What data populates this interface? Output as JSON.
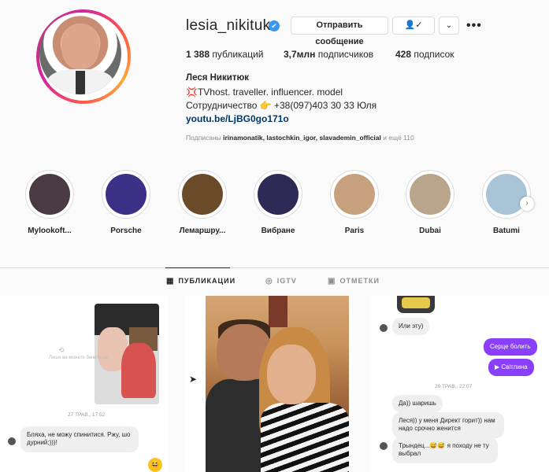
{
  "profile": {
    "username": "lesia_nikituk",
    "verified_glyph": "✔",
    "message_button": "Отправить сообщение",
    "follow_glyph": "👤✓",
    "dropdown_glyph": "⌄",
    "more_glyph": "•••",
    "posts_count": "1 388",
    "posts_label": "публикаций",
    "followers_count": "3,7млн",
    "followers_label": "подписчиков",
    "following_count": "428",
    "following_label": "подписок",
    "full_name": "Леся Никитюк",
    "bio_line1": "💢TVhost. traveller. influencer. model",
    "bio_line2": "Сотрудничество 👉 +38(097)403 30 33 Юля",
    "link": "youtu.be/LjBG0go171o",
    "followed_by_prefix": "Подписаны",
    "followed_by_names": "irinamonatik, lastochkin_igor, slavademin_official",
    "followed_by_suffix": "и ещё 110"
  },
  "highlights": [
    {
      "label": "Mylookoft...",
      "color": "#4a3a44"
    },
    {
      "label": "Porsche",
      "color": "#3b2f86"
    },
    {
      "label": "Лемаршру...",
      "color": "#6b4a2a"
    },
    {
      "label": "Вибране",
      "color": "#2d2a55"
    },
    {
      "label": "Paris",
      "color": "#c7a07d"
    },
    {
      "label": "Dubai",
      "color": "#b9a58c"
    },
    {
      "label": "Batumi",
      "color": "#a9c4d6"
    }
  ],
  "tabs": {
    "posts": "ПУБЛИКАЦИИ",
    "igtv": "IGTV",
    "tagged": "ОТМЕТКИ"
  },
  "post1": {
    "missed_call": "Лише ви можете бачити це",
    "time": "27 ТРАВ., 17:52",
    "message": "Бляха, не можу спинитися. Ржу, шо дурний;)))!"
  },
  "post3": {
    "msg1": "Или эту)",
    "msg2": "Серце болить",
    "msg3": "▶ Світлина",
    "time": "20 ТРАВ., 22:07",
    "msg4": "Да)) шаришь",
    "msg5": "Леся)) у меня Директ горит)) нам надо срочно женится",
    "msg6": "Трындец...😅😅 я походу не ту выбрал"
  }
}
